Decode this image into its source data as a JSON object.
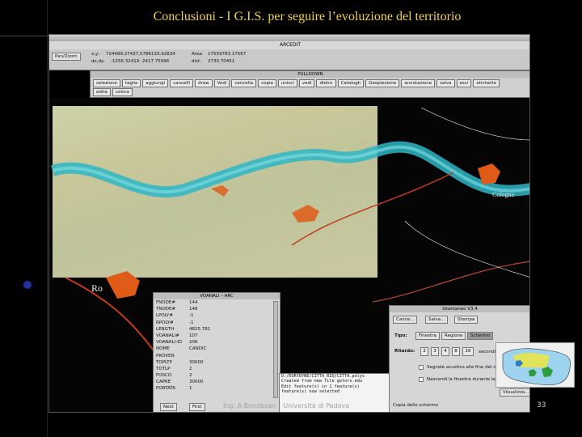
{
  "slide": {
    "title": "Conclusioni - I G.I.S. per seguire l’evoluzione del territorio",
    "footer": "Ing. A Bondesan – Università di Padova",
    "page_number": "33"
  },
  "arcedit": {
    "title": "ARCEDIT",
    "pan_zoom": "Pan/Zoom",
    "xy_label": "x,y:",
    "xy_value": "724489.27437,5786133.92834",
    "dxdy_label": "dx,dy:",
    "dxdy_value": "-1256.32419 -2417.75996",
    "area_label": "Area:",
    "area_value": "17559783.17567",
    "dist_label": "dist:",
    "dist_value": "2730.70451"
  },
  "ribbon": {
    "title": "PULLDOWN",
    "row1": [
      "selezione",
      "taglia",
      "aggiungi",
      "cancelli",
      "draw",
      "Vedi",
      "cancella",
      "copia",
      "unisci",
      "vedi",
      "dietro",
      "Catalogh",
      "Geoplezione",
      "annotazione",
      "salva",
      "esci",
      "etichette"
    ],
    "row2": [
      "edita",
      "colora"
    ]
  },
  "attributes": {
    "title": "VOANALI – ARC",
    "rows": [
      {
        "key": "FNODE#",
        "value": "144"
      },
      {
        "key": "TNODE#",
        "value": "148"
      },
      {
        "key": "LPOLY#",
        "value": "-1"
      },
      {
        "key": "RPOLY#",
        "value": "-1"
      },
      {
        "key": "LENGTH",
        "value": "4825.781"
      },
      {
        "key": "VOANALI#",
        "value": "107"
      },
      {
        "key": "VOANALI-ID",
        "value": "206"
      },
      {
        "key": "NOME",
        "value": "CANDIC"
      },
      {
        "key": "PROVEN",
        "value": ""
      },
      {
        "key": "TOPLTP",
        "value": "30000"
      },
      {
        "key": "TOTLP",
        "value": "2"
      },
      {
        "key": "FOSCO",
        "value": "2"
      },
      {
        "key": "CAPRE",
        "value": "30000"
      },
      {
        "key": "PORTATA",
        "value": "1"
      }
    ],
    "next_label": "Next",
    "first_label": "First"
  },
  "console": {
    "lines": [
      "D:/EURYDYNE/CITTA_RIO/CITTA.polys",
      "Created from new file getors.edu",
      "Edit feature(s) in 1 feature(s)",
      "feature(s) now selected"
    ]
  },
  "istantaneo": {
    "title": "Istantaneo V3.4",
    "cancel_label": "Cance...",
    "save_label": "Salva...",
    "print_label": "Stampa",
    "tipo_label": "Tipo:",
    "tipo_options": [
      "Finestra",
      "Regione",
      "Schermo"
    ],
    "selected_tipo": "Schermo",
    "ritardo_label": "Ritardo:",
    "ritardo_values": [
      "2",
      "3",
      "4",
      "8",
      "16"
    ],
    "seconds_label": "secondi",
    "option1": "Segnale acustico alla fine del conteggio",
    "option2": "Nascondi la finestra durante la cattura",
    "view_label": "Visualizza...",
    "description": "Copia dello schermo"
  },
  "map": {
    "labels": {
      "cologna": "Cologna",
      "ro": "Ro"
    },
    "colors": {
      "river": "#2fb6c6",
      "urban": "#e05a18",
      "scan": "#c9c89e"
    }
  }
}
